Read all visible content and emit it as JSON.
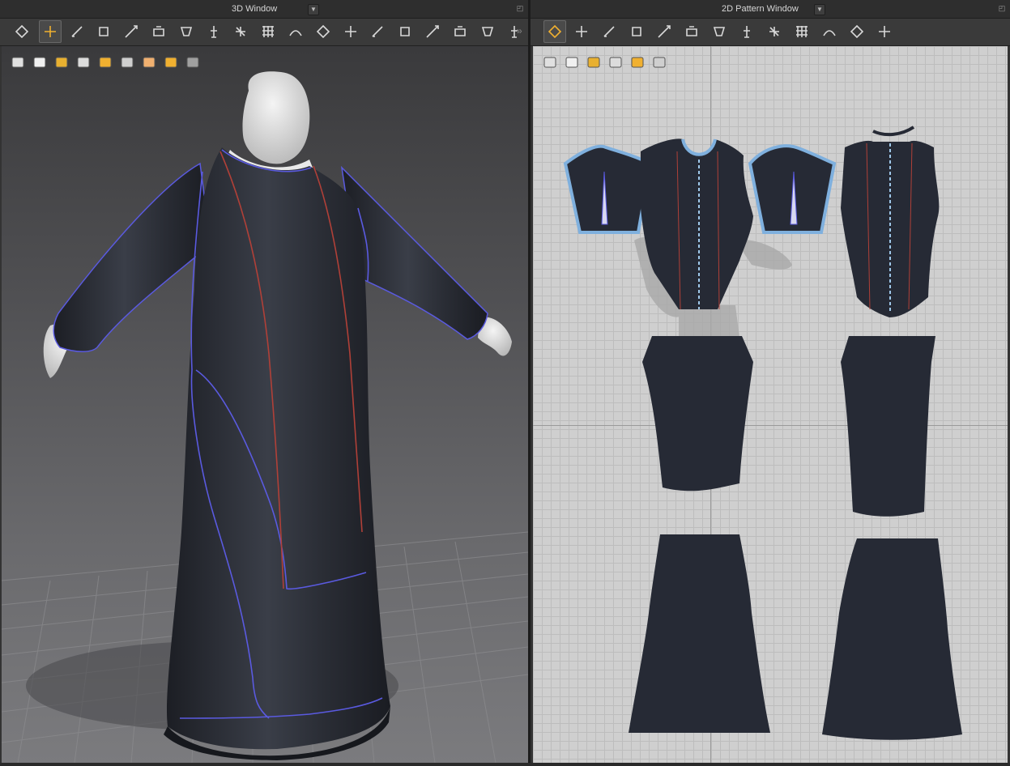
{
  "window3d": {
    "title": "3D Window",
    "toolbar": [
      "select-move-icon",
      "transform-icon",
      "edit-pattern-icon",
      "simulation-icon",
      "pin-icon",
      "arrangement-icon",
      "fold-icon",
      "avatar-icon",
      "tack-icon",
      "grid-sim-icon",
      "seam-icon",
      "sewing-icon",
      "button-icon",
      "zipper-icon",
      "piping-icon",
      "topstitch-icon",
      "puckering-icon",
      "measure-icon",
      "cut-icon"
    ],
    "subtools": [
      "show-garment-icon",
      "show-avatar-icon",
      "texture-icon",
      "avatar-skin-icon",
      "fabric-icon",
      "flat-shading-icon",
      "face-icon",
      "wireframe-icon",
      "export-icon"
    ],
    "active_tool": 1
  },
  "window2d": {
    "title": "2D Pattern Window",
    "toolbar": [
      "transform-pattern-icon",
      "edit-points-icon",
      "polygon-icon",
      "rectangle-icon",
      "internal-polygon-icon",
      "trace-icon",
      "grid-icon",
      "fold-arrangement-icon",
      "segment-sewing-icon",
      "free-sewing-icon",
      "pleat-icon",
      "cut-line-icon",
      "garment-icon"
    ],
    "subtools": [
      "pen-icon",
      "tshirt-icon",
      "info-icon",
      "fabric-swatch-icon",
      "pattern-icon",
      "export-pattern-icon"
    ],
    "active_tool": 0
  },
  "colors": {
    "garment": "#262a35",
    "outline": "#7fb0de",
    "seam_red": "#b04038",
    "seam_blue": "#5a5ae0",
    "accent": "#f0b030"
  }
}
